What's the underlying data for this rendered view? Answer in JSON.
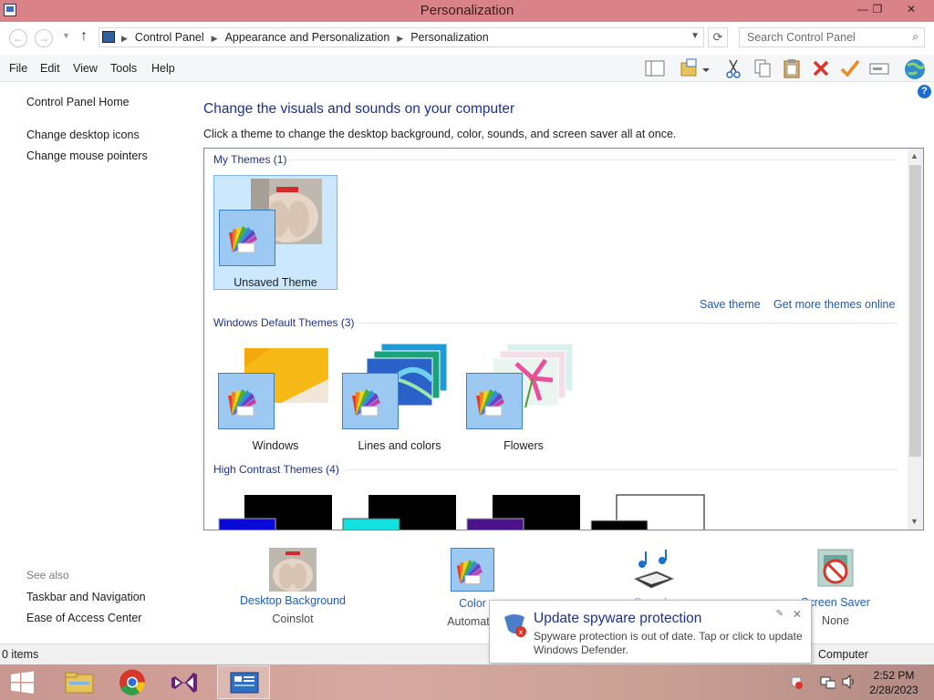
{
  "window": {
    "title": "Personalization",
    "controls": {
      "minimize": "—",
      "restore": "❐",
      "close": "✕"
    }
  },
  "address": {
    "crumbs": [
      "Control Panel",
      "Appearance and Personalization",
      "Personalization"
    ],
    "search_placeholder": "Search Control Panel"
  },
  "menu": {
    "file": "File",
    "edit": "Edit",
    "view": "View",
    "tools": "Tools",
    "help": "Help"
  },
  "sidebar": {
    "home": "Control Panel Home",
    "links": [
      "Change desktop icons",
      "Change mouse pointers"
    ],
    "see_also_label": "See also",
    "see_also": [
      "Taskbar and Navigation",
      "Ease of Access Center"
    ]
  },
  "main": {
    "heading": "Change the visuals and sounds on your computer",
    "subtext": "Click a theme to change the desktop background, color, sounds, and screen saver all at once.",
    "groups": {
      "my": "My Themes (1)",
      "default": "Windows Default Themes (3)",
      "contrast": "High Contrast Themes (4)"
    },
    "my_themes": [
      {
        "label": "Unsaved Theme",
        "selected": true
      }
    ],
    "default_themes": [
      {
        "label": "Windows"
      },
      {
        "label": "Lines and colors"
      },
      {
        "label": "Flowers"
      }
    ],
    "save_theme": "Save theme",
    "more_themes": "Get more themes online"
  },
  "bottom": {
    "desktop_bg": {
      "label": "Desktop Background",
      "value": "Coinslot"
    },
    "color": {
      "label": "Color",
      "value": "Automatic"
    },
    "sounds": {
      "label": "Sounds"
    },
    "screensaver": {
      "label": "Screen Saver",
      "value": "None"
    }
  },
  "status": {
    "count": "0 items",
    "location": "Computer"
  },
  "toast": {
    "title": "Update spyware protection",
    "body": "Spyware protection is out of date. Tap or click to update Windows Defender."
  },
  "clock": {
    "time": "2:52 PM",
    "date": "2/28/2023"
  },
  "colors": {
    "titlebar": "#d98288",
    "link": "#1f5bb0",
    "heading": "#1e3287",
    "selection": "#cce8ff"
  }
}
